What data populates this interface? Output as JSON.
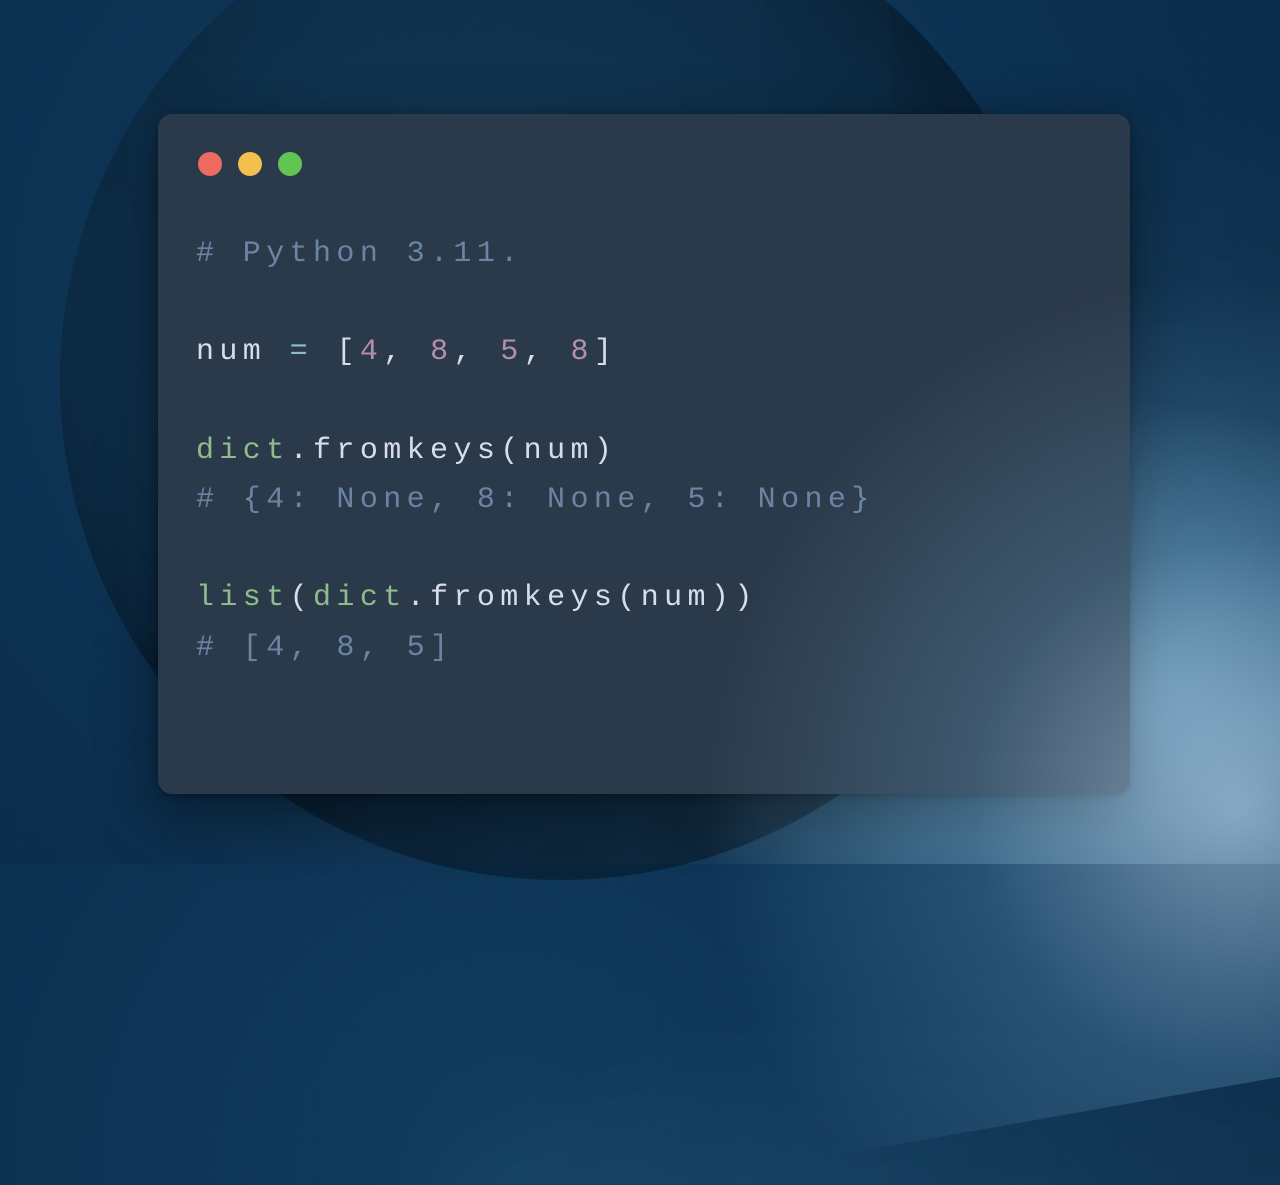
{
  "window": {
    "traffic_lights": {
      "red": "#ed6a5e",
      "yellow": "#f4bf4f",
      "green": "#61c554"
    }
  },
  "code": {
    "line1_comment": "# Python 3.11.",
    "line3_var": "num",
    "line3_eq": " = ",
    "line3_open": "[",
    "line3_n1": "4",
    "line3_c1": ", ",
    "line3_n2": "8",
    "line3_c2": ", ",
    "line3_n3": "5",
    "line3_c3": ", ",
    "line3_n4": "8",
    "line3_close": "]",
    "line5_builtin": "dict",
    "line5_dot": ".",
    "line5_method": "fromkeys",
    "line5_open": "(",
    "line5_arg": "num",
    "line5_close": ")",
    "line6_comment": "# {4: None, 8: None, 5: None}",
    "line8_builtin1": "list",
    "line8_open1": "(",
    "line8_builtin2": "dict",
    "line8_dot": ".",
    "line8_method": "fromkeys",
    "line8_open2": "(",
    "line8_arg": "num",
    "line8_close2": ")",
    "line8_close1": ")",
    "line9_comment": "# [4, 8, 5]"
  }
}
